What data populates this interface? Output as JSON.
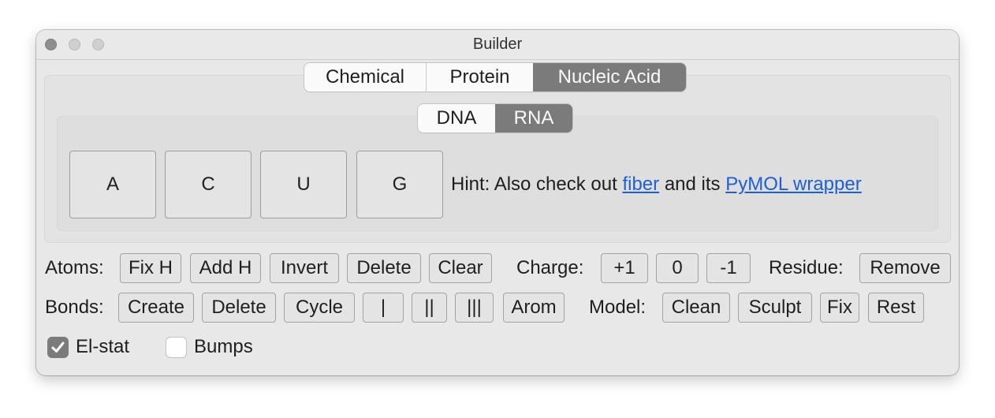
{
  "window": {
    "title": "Builder",
    "controls": [
      "close",
      "minimize",
      "maximize"
    ]
  },
  "mode_tabs": {
    "items": [
      "Chemical",
      "Protein",
      "Nucleic Acid"
    ],
    "selected": "Nucleic Acid"
  },
  "type_tabs": {
    "items": [
      "DNA",
      "RNA"
    ],
    "selected": "RNA"
  },
  "nucleotides": [
    "A",
    "C",
    "U",
    "G"
  ],
  "hint": {
    "prefix": "Hint: Also check out",
    "link1": "fiber",
    "middle": "and its",
    "link2": "PyMOL wrapper",
    "link_color": "#1d5fd4"
  },
  "atoms": {
    "label": "Atoms:",
    "buttons": [
      "Fix H",
      "Add H",
      "Invert",
      "Delete",
      "Clear"
    ]
  },
  "charge": {
    "label": "Charge:",
    "buttons": [
      "+1",
      "0",
      "-1"
    ]
  },
  "residue": {
    "label": "Residue:",
    "buttons": [
      "Remove"
    ]
  },
  "bonds": {
    "label": "Bonds:",
    "buttons": [
      "Create",
      "Delete",
      "Cycle",
      "|",
      "||",
      "|||",
      "Arom"
    ]
  },
  "model": {
    "label": "Model:",
    "buttons": [
      "Clean",
      "Sculpt",
      "Fix",
      "Rest"
    ]
  },
  "options": [
    {
      "label": "El-stat",
      "checked": true
    },
    {
      "label": "Bumps",
      "checked": false
    }
  ],
  "colors": {
    "selected_segment": "#7b7b7b",
    "window_bg": "#e8e8e8"
  }
}
